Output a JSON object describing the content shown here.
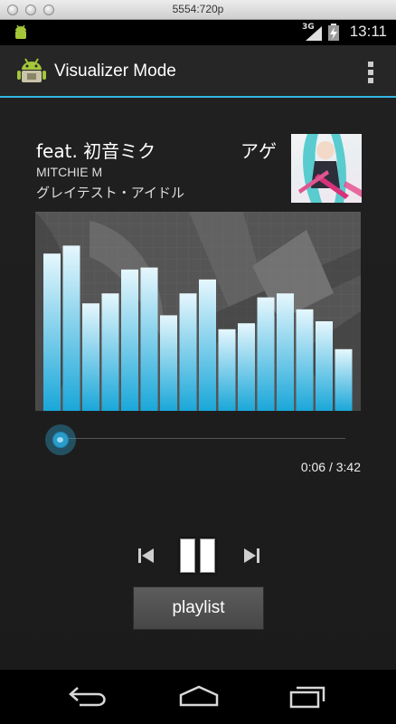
{
  "window": {
    "title": "5554:720p"
  },
  "status_bar": {
    "network": "3G",
    "time": "13:11"
  },
  "action_bar": {
    "title": "Visualizer Mode",
    "icon": "android-app-icon",
    "overflow_icon": "overflow-menu-icon"
  },
  "track": {
    "title_visible_part": "feat. 初音ミク",
    "title_scrolling_part": "アゲ",
    "artist": "MITCHIE M",
    "album": "グレイテスト・アイドル"
  },
  "visualizer": {
    "bar_levels": [
      0.79,
      0.83,
      0.54,
      0.59,
      0.71,
      0.72,
      0.48,
      0.59,
      0.66,
      0.41,
      0.44,
      0.57,
      0.59,
      0.51,
      0.45,
      0.31
    ],
    "max_level": 1.0,
    "bar_color_top": "#e6f7fd",
    "bar_color_bottom": "#1aa7d9"
  },
  "playback": {
    "position": "0:06",
    "duration": "3:42",
    "progress_fraction": 0.027,
    "time_text": "0:06 / 3:42"
  },
  "controls": {
    "prev_icon": "skip-previous-icon",
    "pause_icon": "pause-icon",
    "next_icon": "skip-next-icon",
    "playlist_label": "playlist"
  },
  "nav_bar": {
    "back_icon": "back-icon",
    "home_icon": "home-icon",
    "recents_icon": "recents-icon"
  },
  "colors": {
    "accent": "#33b5e5",
    "background": "#1d1d1d"
  }
}
